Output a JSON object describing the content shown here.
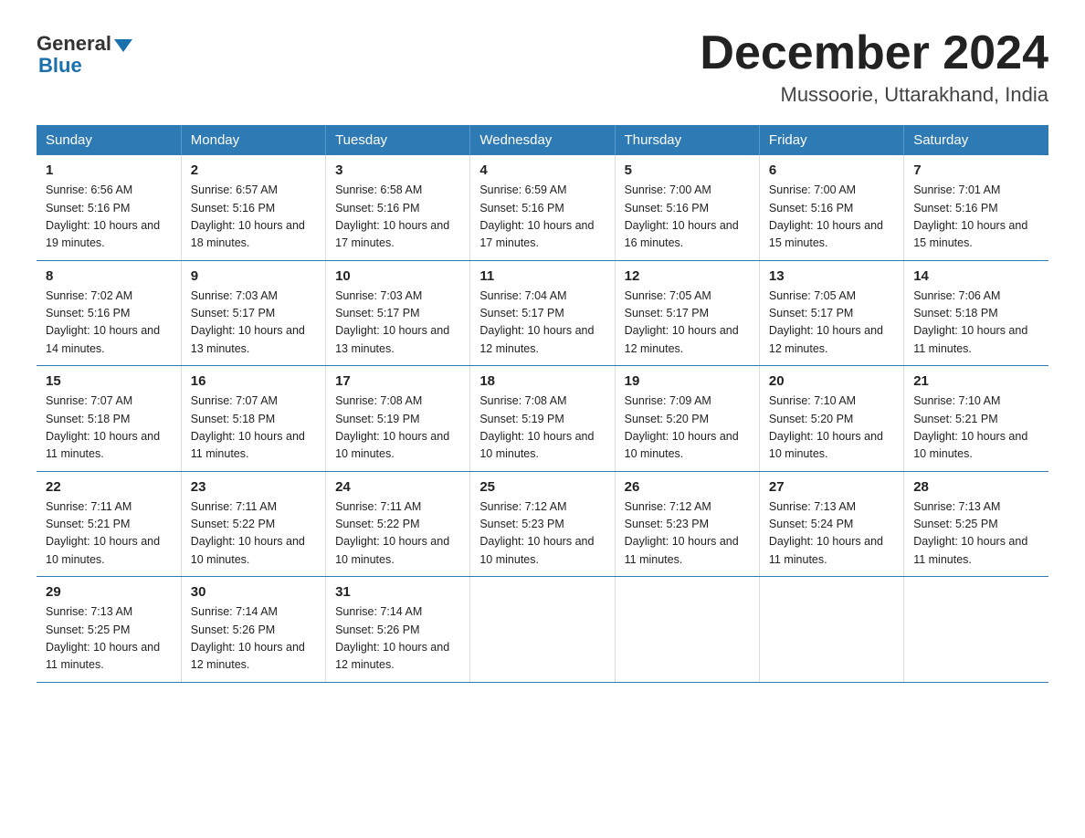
{
  "header": {
    "logo_general": "General",
    "logo_blue": "Blue",
    "title": "December 2024",
    "subtitle": "Mussoorie, Uttarakhand, India"
  },
  "calendar": {
    "days_of_week": [
      "Sunday",
      "Monday",
      "Tuesday",
      "Wednesday",
      "Thursday",
      "Friday",
      "Saturday"
    ],
    "weeks": [
      [
        {
          "day": "1",
          "sunrise": "6:56 AM",
          "sunset": "5:16 PM",
          "daylight": "10 hours and 19 minutes."
        },
        {
          "day": "2",
          "sunrise": "6:57 AM",
          "sunset": "5:16 PM",
          "daylight": "10 hours and 18 minutes."
        },
        {
          "day": "3",
          "sunrise": "6:58 AM",
          "sunset": "5:16 PM",
          "daylight": "10 hours and 17 minutes."
        },
        {
          "day": "4",
          "sunrise": "6:59 AM",
          "sunset": "5:16 PM",
          "daylight": "10 hours and 17 minutes."
        },
        {
          "day": "5",
          "sunrise": "7:00 AM",
          "sunset": "5:16 PM",
          "daylight": "10 hours and 16 minutes."
        },
        {
          "day": "6",
          "sunrise": "7:00 AM",
          "sunset": "5:16 PM",
          "daylight": "10 hours and 15 minutes."
        },
        {
          "day": "7",
          "sunrise": "7:01 AM",
          "sunset": "5:16 PM",
          "daylight": "10 hours and 15 minutes."
        }
      ],
      [
        {
          "day": "8",
          "sunrise": "7:02 AM",
          "sunset": "5:16 PM",
          "daylight": "10 hours and 14 minutes."
        },
        {
          "day": "9",
          "sunrise": "7:03 AM",
          "sunset": "5:17 PM",
          "daylight": "10 hours and 13 minutes."
        },
        {
          "day": "10",
          "sunrise": "7:03 AM",
          "sunset": "5:17 PM",
          "daylight": "10 hours and 13 minutes."
        },
        {
          "day": "11",
          "sunrise": "7:04 AM",
          "sunset": "5:17 PM",
          "daylight": "10 hours and 12 minutes."
        },
        {
          "day": "12",
          "sunrise": "7:05 AM",
          "sunset": "5:17 PM",
          "daylight": "10 hours and 12 minutes."
        },
        {
          "day": "13",
          "sunrise": "7:05 AM",
          "sunset": "5:17 PM",
          "daylight": "10 hours and 12 minutes."
        },
        {
          "day": "14",
          "sunrise": "7:06 AM",
          "sunset": "5:18 PM",
          "daylight": "10 hours and 11 minutes."
        }
      ],
      [
        {
          "day": "15",
          "sunrise": "7:07 AM",
          "sunset": "5:18 PM",
          "daylight": "10 hours and 11 minutes."
        },
        {
          "day": "16",
          "sunrise": "7:07 AM",
          "sunset": "5:18 PM",
          "daylight": "10 hours and 11 minutes."
        },
        {
          "day": "17",
          "sunrise": "7:08 AM",
          "sunset": "5:19 PM",
          "daylight": "10 hours and 10 minutes."
        },
        {
          "day": "18",
          "sunrise": "7:08 AM",
          "sunset": "5:19 PM",
          "daylight": "10 hours and 10 minutes."
        },
        {
          "day": "19",
          "sunrise": "7:09 AM",
          "sunset": "5:20 PM",
          "daylight": "10 hours and 10 minutes."
        },
        {
          "day": "20",
          "sunrise": "7:10 AM",
          "sunset": "5:20 PM",
          "daylight": "10 hours and 10 minutes."
        },
        {
          "day": "21",
          "sunrise": "7:10 AM",
          "sunset": "5:21 PM",
          "daylight": "10 hours and 10 minutes."
        }
      ],
      [
        {
          "day": "22",
          "sunrise": "7:11 AM",
          "sunset": "5:21 PM",
          "daylight": "10 hours and 10 minutes."
        },
        {
          "day": "23",
          "sunrise": "7:11 AM",
          "sunset": "5:22 PM",
          "daylight": "10 hours and 10 minutes."
        },
        {
          "day": "24",
          "sunrise": "7:11 AM",
          "sunset": "5:22 PM",
          "daylight": "10 hours and 10 minutes."
        },
        {
          "day": "25",
          "sunrise": "7:12 AM",
          "sunset": "5:23 PM",
          "daylight": "10 hours and 10 minutes."
        },
        {
          "day": "26",
          "sunrise": "7:12 AM",
          "sunset": "5:23 PM",
          "daylight": "10 hours and 11 minutes."
        },
        {
          "day": "27",
          "sunrise": "7:13 AM",
          "sunset": "5:24 PM",
          "daylight": "10 hours and 11 minutes."
        },
        {
          "day": "28",
          "sunrise": "7:13 AM",
          "sunset": "5:25 PM",
          "daylight": "10 hours and 11 minutes."
        }
      ],
      [
        {
          "day": "29",
          "sunrise": "7:13 AM",
          "sunset": "5:25 PM",
          "daylight": "10 hours and 11 minutes."
        },
        {
          "day": "30",
          "sunrise": "7:14 AM",
          "sunset": "5:26 PM",
          "daylight": "10 hours and 12 minutes."
        },
        {
          "day": "31",
          "sunrise": "7:14 AM",
          "sunset": "5:26 PM",
          "daylight": "10 hours and 12 minutes."
        },
        null,
        null,
        null,
        null
      ]
    ]
  }
}
